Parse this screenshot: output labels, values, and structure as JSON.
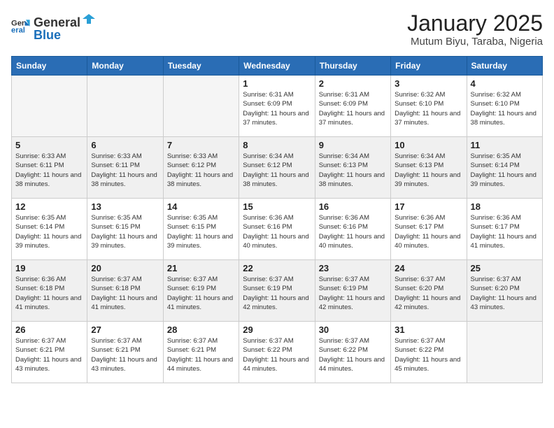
{
  "header": {
    "logo_general": "General",
    "logo_blue": "Blue",
    "month_title": "January 2025",
    "location": "Mutum Biyu, Taraba, Nigeria"
  },
  "days": [
    "Sunday",
    "Monday",
    "Tuesday",
    "Wednesday",
    "Thursday",
    "Friday",
    "Saturday"
  ],
  "weeks": [
    [
      {
        "day": "",
        "info": ""
      },
      {
        "day": "",
        "info": ""
      },
      {
        "day": "",
        "info": ""
      },
      {
        "day": "1",
        "info": "Sunrise: 6:31 AM\nSunset: 6:09 PM\nDaylight: 11 hours\nand 37 minutes."
      },
      {
        "day": "2",
        "info": "Sunrise: 6:31 AM\nSunset: 6:09 PM\nDaylight: 11 hours\nand 37 minutes."
      },
      {
        "day": "3",
        "info": "Sunrise: 6:32 AM\nSunset: 6:10 PM\nDaylight: 11 hours\nand 37 minutes."
      },
      {
        "day": "4",
        "info": "Sunrise: 6:32 AM\nSunset: 6:10 PM\nDaylight: 11 hours\nand 38 minutes."
      }
    ],
    [
      {
        "day": "5",
        "info": "Sunrise: 6:33 AM\nSunset: 6:11 PM\nDaylight: 11 hours\nand 38 minutes."
      },
      {
        "day": "6",
        "info": "Sunrise: 6:33 AM\nSunset: 6:11 PM\nDaylight: 11 hours\nand 38 minutes."
      },
      {
        "day": "7",
        "info": "Sunrise: 6:33 AM\nSunset: 6:12 PM\nDaylight: 11 hours\nand 38 minutes."
      },
      {
        "day": "8",
        "info": "Sunrise: 6:34 AM\nSunset: 6:12 PM\nDaylight: 11 hours\nand 38 minutes."
      },
      {
        "day": "9",
        "info": "Sunrise: 6:34 AM\nSunset: 6:13 PM\nDaylight: 11 hours\nand 38 minutes."
      },
      {
        "day": "10",
        "info": "Sunrise: 6:34 AM\nSunset: 6:13 PM\nDaylight: 11 hours\nand 39 minutes."
      },
      {
        "day": "11",
        "info": "Sunrise: 6:35 AM\nSunset: 6:14 PM\nDaylight: 11 hours\nand 39 minutes."
      }
    ],
    [
      {
        "day": "12",
        "info": "Sunrise: 6:35 AM\nSunset: 6:14 PM\nDaylight: 11 hours\nand 39 minutes."
      },
      {
        "day": "13",
        "info": "Sunrise: 6:35 AM\nSunset: 6:15 PM\nDaylight: 11 hours\nand 39 minutes."
      },
      {
        "day": "14",
        "info": "Sunrise: 6:35 AM\nSunset: 6:15 PM\nDaylight: 11 hours\nand 39 minutes."
      },
      {
        "day": "15",
        "info": "Sunrise: 6:36 AM\nSunset: 6:16 PM\nDaylight: 11 hours\nand 40 minutes."
      },
      {
        "day": "16",
        "info": "Sunrise: 6:36 AM\nSunset: 6:16 PM\nDaylight: 11 hours\nand 40 minutes."
      },
      {
        "day": "17",
        "info": "Sunrise: 6:36 AM\nSunset: 6:17 PM\nDaylight: 11 hours\nand 40 minutes."
      },
      {
        "day": "18",
        "info": "Sunrise: 6:36 AM\nSunset: 6:17 PM\nDaylight: 11 hours\nand 41 minutes."
      }
    ],
    [
      {
        "day": "19",
        "info": "Sunrise: 6:36 AM\nSunset: 6:18 PM\nDaylight: 11 hours\nand 41 minutes."
      },
      {
        "day": "20",
        "info": "Sunrise: 6:37 AM\nSunset: 6:18 PM\nDaylight: 11 hours\nand 41 minutes."
      },
      {
        "day": "21",
        "info": "Sunrise: 6:37 AM\nSunset: 6:19 PM\nDaylight: 11 hours\nand 41 minutes."
      },
      {
        "day": "22",
        "info": "Sunrise: 6:37 AM\nSunset: 6:19 PM\nDaylight: 11 hours\nand 42 minutes."
      },
      {
        "day": "23",
        "info": "Sunrise: 6:37 AM\nSunset: 6:19 PM\nDaylight: 11 hours\nand 42 minutes."
      },
      {
        "day": "24",
        "info": "Sunrise: 6:37 AM\nSunset: 6:20 PM\nDaylight: 11 hours\nand 42 minutes."
      },
      {
        "day": "25",
        "info": "Sunrise: 6:37 AM\nSunset: 6:20 PM\nDaylight: 11 hours\nand 43 minutes."
      }
    ],
    [
      {
        "day": "26",
        "info": "Sunrise: 6:37 AM\nSunset: 6:21 PM\nDaylight: 11 hours\nand 43 minutes."
      },
      {
        "day": "27",
        "info": "Sunrise: 6:37 AM\nSunset: 6:21 PM\nDaylight: 11 hours\nand 43 minutes."
      },
      {
        "day": "28",
        "info": "Sunrise: 6:37 AM\nSunset: 6:21 PM\nDaylight: 11 hours\nand 44 minutes."
      },
      {
        "day": "29",
        "info": "Sunrise: 6:37 AM\nSunset: 6:22 PM\nDaylight: 11 hours\nand 44 minutes."
      },
      {
        "day": "30",
        "info": "Sunrise: 6:37 AM\nSunset: 6:22 PM\nDaylight: 11 hours\nand 44 minutes."
      },
      {
        "day": "31",
        "info": "Sunrise: 6:37 AM\nSunset: 6:22 PM\nDaylight: 11 hours\nand 45 minutes."
      },
      {
        "day": "",
        "info": ""
      }
    ]
  ]
}
